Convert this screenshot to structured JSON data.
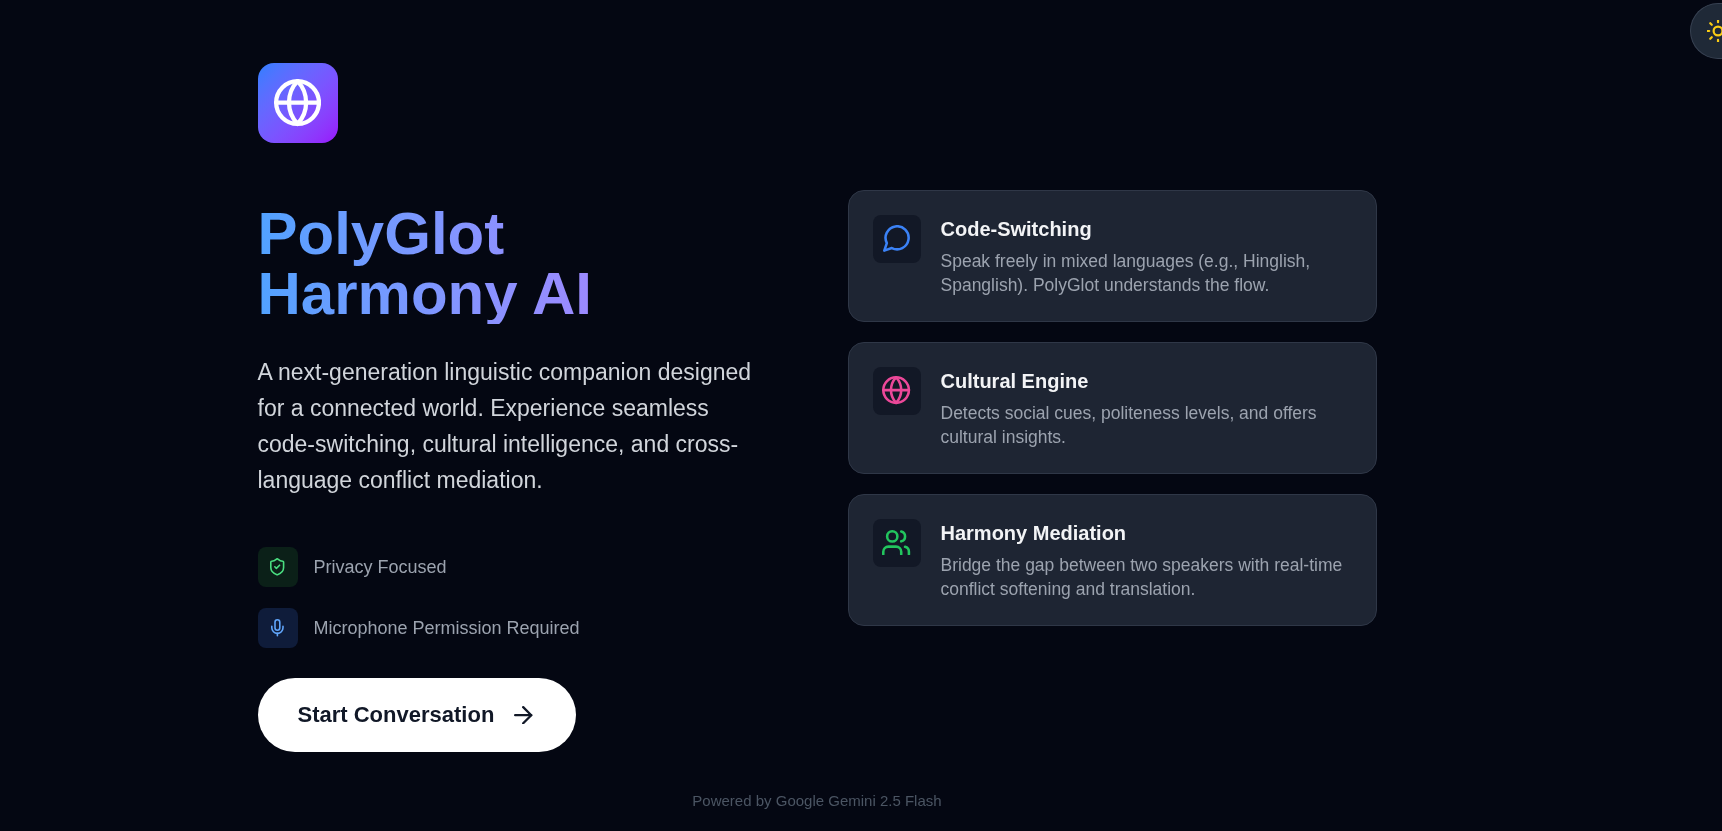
{
  "hero": {
    "title": "PolyGlot Harmony AI",
    "description": "A next-generation linguistic companion designed for a connected world. Experience seamless code-switching, cultural intelligence, and cross-language conflict mediation.",
    "notes": [
      {
        "kind": "privacy",
        "label": "Privacy Focused"
      },
      {
        "kind": "microphone",
        "label": "Microphone Permission Required"
      }
    ],
    "cta": {
      "label": "Start Conversation"
    }
  },
  "features": [
    {
      "kind": "chat",
      "title": "Code-Switching",
      "description": "Speak freely in mixed languages (e.g., Hinglish, Spanglish). PolyGlot understands the flow."
    },
    {
      "kind": "globe",
      "title": "Cultural Engine",
      "description": "Detects social cues, politeness levels, and offers cultural insights."
    },
    {
      "kind": "people",
      "title": "Harmony Mediation",
      "description": "Bridge the gap between two speakers with real-time conflict softening and translation."
    }
  ],
  "footer": "Powered by Google Gemini 2.5 Flash"
}
